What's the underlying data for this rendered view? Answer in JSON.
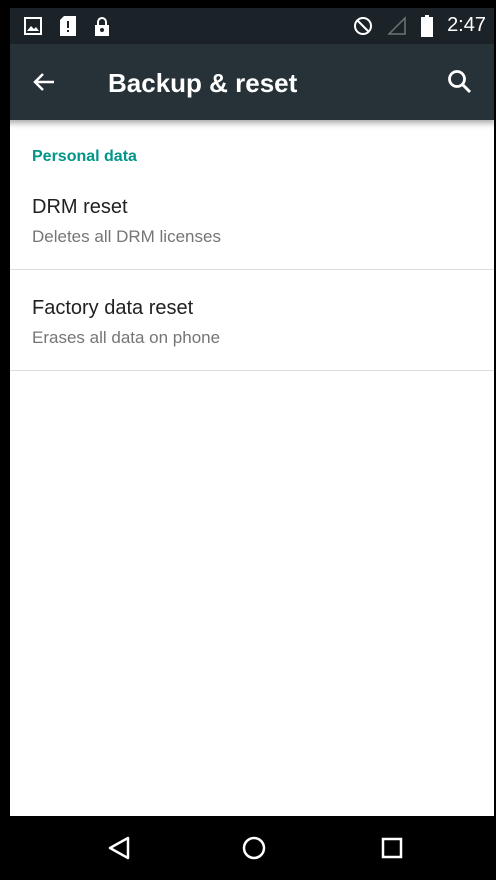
{
  "status_bar": {
    "time": "2:47",
    "icons": [
      "image-icon",
      "sd-card-icon",
      "lock-icon",
      "do-not-disturb-icon",
      "signal-icon",
      "battery-icon"
    ]
  },
  "app_bar": {
    "title": "Backup & reset",
    "back_icon": "arrow-back-icon",
    "search_icon": "search-icon",
    "color": "#263238"
  },
  "content": {
    "section_header": "Personal data",
    "accent_color": "#009688",
    "items": [
      {
        "title": "DRM reset",
        "summary": "Deletes all DRM licenses"
      },
      {
        "title": "Factory data reset",
        "summary": "Erases all data on phone"
      }
    ]
  },
  "nav_bar": {
    "buttons": [
      "back-triangle-icon",
      "home-circle-icon",
      "recents-square-icon"
    ]
  }
}
